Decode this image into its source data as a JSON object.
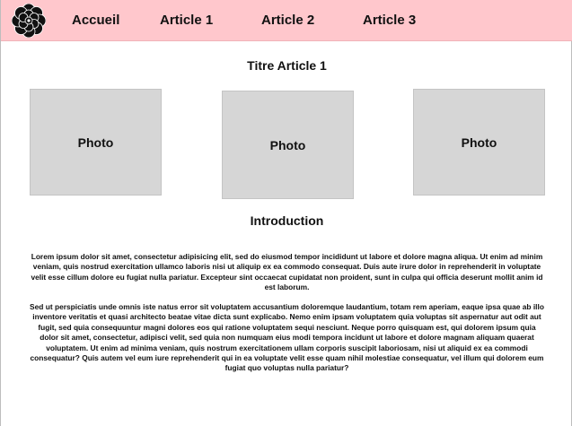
{
  "nav": {
    "logo_icon": "flower-icon",
    "items": [
      "Accueil",
      "Article 1",
      "Article 2",
      "Article 3"
    ]
  },
  "main": {
    "title": "Titre Article 1",
    "photos": [
      "Photo",
      "Photo",
      "Photo"
    ],
    "intro_heading": "Introduction",
    "paragraphs": [
      "Lorem ipsum dolor sit amet, consectetur adipisicing elit, sed do eiusmod tempor incididunt ut labore et dolore magna aliqua. Ut enim ad minim veniam, quis nostrud exercitation ullamco laboris nisi ut aliquip ex ea commodo consequat. Duis aute irure dolor in reprehenderit in voluptate velit esse cillum dolore eu fugiat nulla pariatur. Excepteur sint occaecat cupidatat non proident, sunt in culpa qui officia deserunt mollit anim id est laborum.",
      "Sed ut perspiciatis unde omnis iste natus error sit voluptatem accusantium doloremque laudantium, totam rem aperiam, eaque ipsa quae ab illo inventore veritatis et quasi architecto beatae vitae dicta sunt explicabo. Nemo enim ipsam voluptatem quia voluptas sit aspernatur aut odit aut fugit, sed quia consequuntur magni dolores eos qui ratione voluptatem sequi nesciunt. Neque porro quisquam est, qui dolorem ipsum quia dolor sit amet, consectetur, adipisci velit, sed quia non numquam eius modi tempora incidunt ut labore et dolore magnam aliquam quaerat voluptatem. Ut enim ad minima veniam, quis nostrum exercitationem ullam corporis suscipit laboriosam, nisi ut aliquid ex ea commodi consequatur? Quis autem vel eum iure reprehenderit qui in ea voluptate velit esse quam nihil molestiae consequatur, vel illum qui dolorem eum fugiat quo voluptas nulla pariatur?"
    ]
  },
  "colors": {
    "navbar_bg": "#ffc7cc",
    "photo_bg": "#d6d6d6"
  }
}
